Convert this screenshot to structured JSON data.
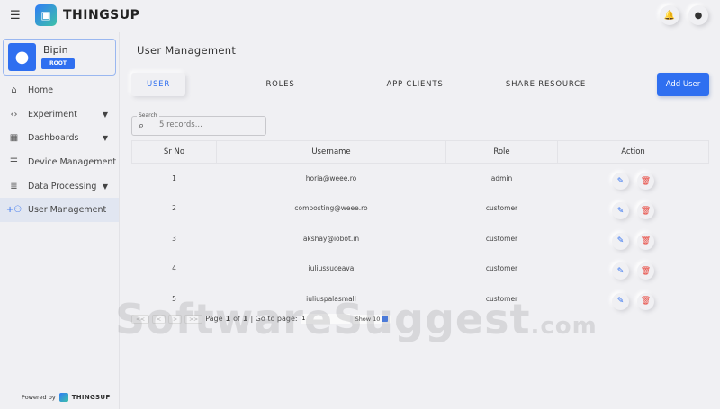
{
  "header": {
    "brand": "THINGSUP",
    "menu_icon": "menu-icon",
    "notification_icon": "bell-icon",
    "account_icon": "person-icon"
  },
  "user": {
    "name": "Bipin",
    "role": "ROOT"
  },
  "sidebar": {
    "items": [
      {
        "label": "Home",
        "icon": "⌂",
        "expand": false
      },
      {
        "label": "Experiment",
        "icon": "‹›",
        "expand": true
      },
      {
        "label": "Dashboards",
        "icon": "▦",
        "expand": true
      },
      {
        "label": "Device Management",
        "icon": "☰",
        "expand": false
      },
      {
        "label": "Data Processing",
        "icon": "≣",
        "expand": true
      },
      {
        "label": "User Management",
        "icon": "+⚇",
        "expand": false,
        "active": true
      }
    ],
    "powered_by": "Powered by",
    "powered_brand": "THINGSUP"
  },
  "main": {
    "title": "User Management",
    "tabs": [
      "USER",
      "ROLES",
      "APP CLIENTS",
      "SHARE RESOURCE"
    ],
    "add_button": "Add User",
    "search": {
      "label": "Search",
      "placeholder": "5 records..."
    },
    "columns": [
      "Sr No",
      "Username",
      "Role",
      "Action"
    ],
    "rows": [
      {
        "sr": "1",
        "username": "horia@weee.ro",
        "role": "admin"
      },
      {
        "sr": "2",
        "username": "composting@weee.ro",
        "role": "customer"
      },
      {
        "sr": "3",
        "username": "akshay@iobot.in",
        "role": "customer"
      },
      {
        "sr": "4",
        "username": "iuliussuceava",
        "role": "customer"
      },
      {
        "sr": "5",
        "username": "iuliuspalasmall",
        "role": "customer"
      }
    ],
    "pager": {
      "first": "<<",
      "prev": "<",
      "next": ">",
      "last": ">>",
      "page_text": "Page",
      "current": "1",
      "of": "of",
      "total": "1",
      "goto": "| Go to page:",
      "goto_value": "1",
      "show": "Show 10"
    }
  },
  "watermark": "SoftwareSuggest.com",
  "colors": {
    "accent": "#2f6ff0",
    "delete": "#e8433a"
  }
}
